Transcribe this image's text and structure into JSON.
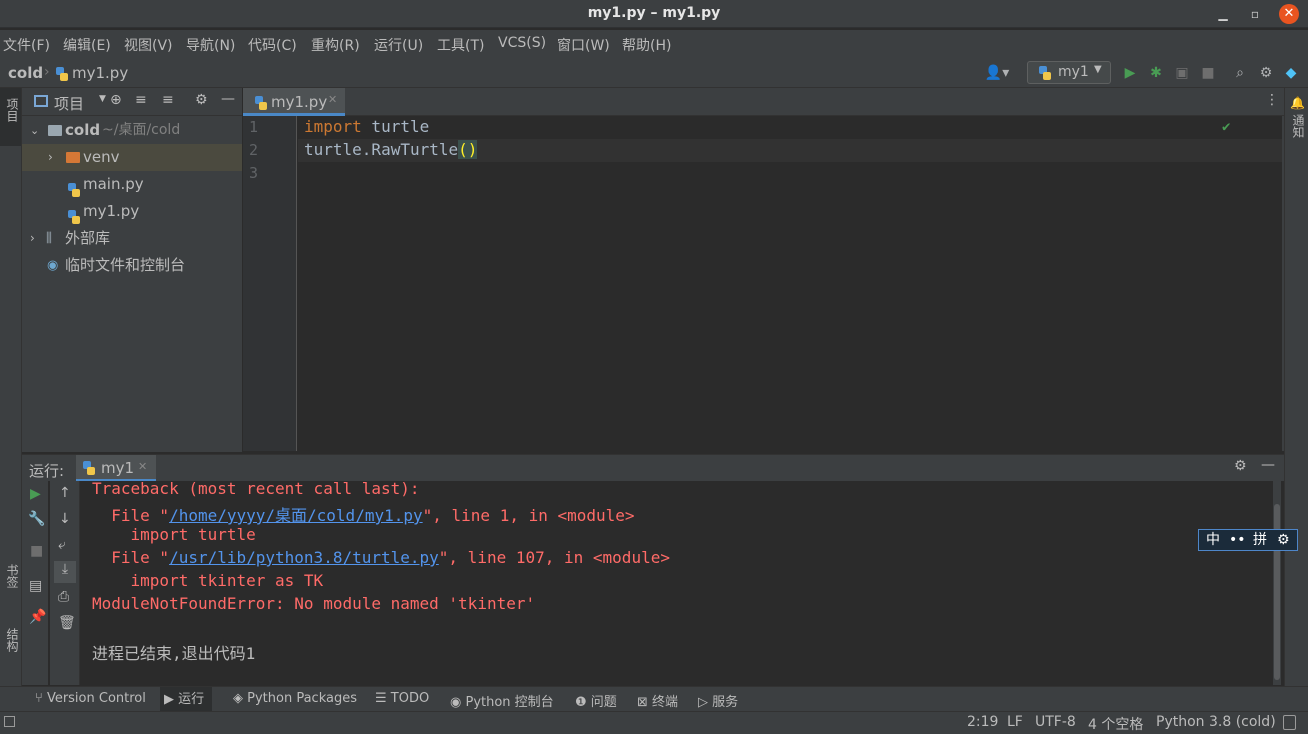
{
  "window": {
    "title": "my1.py – my1.py"
  },
  "menu": [
    "文件(F)",
    "编辑(E)",
    "视图(V)",
    "导航(N)",
    "代码(C)",
    "重构(R)",
    "运行(U)",
    "工具(T)",
    "VCS(S)",
    "窗口(W)",
    "帮助(H)"
  ],
  "breadcrumb": {
    "project": "cold",
    "file": "my1.py"
  },
  "run_config": {
    "name": "my1"
  },
  "left_stripe": {
    "project": "项目",
    "bookmarks": "书签",
    "structure": "结构"
  },
  "right_stripe": {
    "notifications": "通知"
  },
  "project_panel": {
    "title": "项目",
    "tree": [
      {
        "label": "cold",
        "path": "~/桌面/cold"
      },
      {
        "label": "venv"
      },
      {
        "label": "main.py"
      },
      {
        "label": "my1.py"
      },
      {
        "label": "外部库"
      },
      {
        "label": "临时文件和控制台"
      }
    ]
  },
  "editor": {
    "tab": "my1.py",
    "line_numbers": [
      "1",
      "2",
      "3"
    ],
    "lines": [
      {
        "kw": "import",
        "rest": " turtle"
      },
      {
        "text": "turtle.RawTurtle",
        "paren": "()"
      }
    ]
  },
  "run_panel": {
    "label": "运行:",
    "tab": "my1",
    "console": {
      "l1": "Traceback (most recent call last):",
      "l2_pre": "  File \"",
      "l2_link": "/home/yyyy/桌面/cold/my1.py",
      "l2_post": "\", line 1, in <module>",
      "l3": "    import turtle",
      "l4_pre": "  File \"",
      "l4_link": "/usr/lib/python3.8/turtle.py",
      "l4_post": "\", line 107, in <module>",
      "l5": "    import tkinter as TK",
      "l6": "ModuleNotFoundError: No module named 'tkinter'",
      "l7": "进程已结束,退出代码1"
    }
  },
  "ime": {
    "lang": "中",
    "mode": "拼"
  },
  "bottom_tools": [
    "Version Control",
    "运行",
    "Python Packages",
    "TODO",
    "Python 控制台",
    "问题",
    "终端",
    "服务"
  ],
  "status": {
    "position": "2:19",
    "line_sep": "LF",
    "encoding": "UTF-8",
    "indent": "4 个空格",
    "interpreter": "Python 3.8 (cold)"
  }
}
